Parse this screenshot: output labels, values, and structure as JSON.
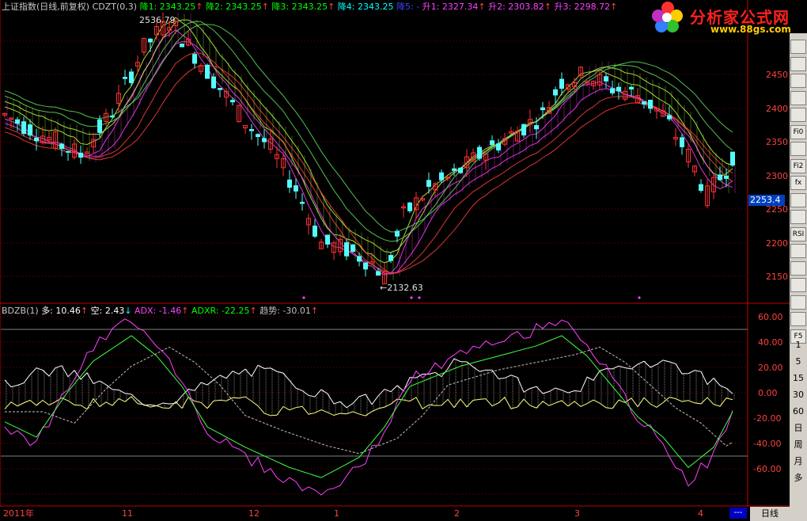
{
  "header": {
    "title": "上证指数(日线,前复权)",
    "indicator": "CDZT(0,3)",
    "items": [
      {
        "label": "降1:",
        "value": "2343.25",
        "color": "#00ff00",
        "arrow": "↑",
        "arrow_color": "#ff4040"
      },
      {
        "label": "降2:",
        "value": "2343.25",
        "color": "#00ff00",
        "arrow": "↑",
        "arrow_color": "#ff4040"
      },
      {
        "label": "降3:",
        "value": "2343.25",
        "color": "#00ff00",
        "arrow": "↑",
        "arrow_color": "#ff4040"
      },
      {
        "label": "降4:",
        "value": "2343.25",
        "color": "#00ffff",
        "arrow": "",
        "arrow_color": "#ff4040"
      },
      {
        "label": "降5:",
        "value": "-",
        "color": "#4040ff",
        "arrow": "",
        "arrow_color": "#ff4040"
      },
      {
        "label": "升1:",
        "value": "2327.34",
        "color": "#ff40ff",
        "arrow": "↑",
        "arrow_color": "#ff4040"
      },
      {
        "label": "升2:",
        "value": "2303.82",
        "color": "#ff40ff",
        "arrow": "↑",
        "arrow_color": "#ff4040"
      },
      {
        "label": "升3:",
        "value": "2298.72",
        "color": "#ff40ff",
        "arrow": "↑",
        "arrow_color": "#ff4040"
      }
    ]
  },
  "logo": {
    "title": "分析家公式网",
    "url": "www.88gs.com"
  },
  "main_panel": {
    "high_marker": "2536.79",
    "low_marker": "←2132.63",
    "current_price": "2253.4",
    "y_ticks": [
      "2450",
      "2400",
      "2350",
      "2300",
      "2250",
      "2200",
      "2150"
    ]
  },
  "sub_panel": {
    "title": "BDZB(1)",
    "items": [
      {
        "label": "多:",
        "value": "10.46",
        "arrow": "↑",
        "color": "#ffffff",
        "arrow_color": "#ff4040"
      },
      {
        "label": "空:",
        "value": "2.43",
        "arrow": "↓",
        "color": "#ffffff",
        "arrow_color": "#00ffff"
      },
      {
        "label": "ADX:",
        "value": "-1.46",
        "arrow": "↑",
        "color": "#ff40ff",
        "arrow_color": "#ff4040"
      },
      {
        "label": "ADXR:",
        "value": "-22.25",
        "arrow": "↑",
        "color": "#00ff00",
        "arrow_color": "#ff4040"
      },
      {
        "label": "趋势:",
        "value": "-30.01",
        "arrow": "↑",
        "color": "#c0c0c0",
        "arrow_color": "#ff4040"
      }
    ],
    "y_ticks": [
      "60.00",
      "40.00",
      "20.00",
      "0.00",
      "-20.00",
      "-40.00",
      "-60.00"
    ]
  },
  "x_axis": {
    "labels": [
      "2011年",
      "11",
      "12",
      "1",
      "2",
      "3",
      "4"
    ]
  },
  "bottom": {
    "period": "日线",
    "nav": "---"
  },
  "toolbar": {
    "buttons": [
      "",
      "",
      "",
      "",
      "",
      "Fi0",
      "",
      "Fi2",
      "fx",
      "",
      "",
      "RSI",
      "",
      "",
      "",
      "",
      "",
      "F5"
    ],
    "numbers": [
      "1",
      "5",
      "15",
      "30",
      "60",
      "日",
      "周",
      "月",
      "多"
    ]
  },
  "colors": {
    "up": "#ff3232",
    "down": "#54fcfc",
    "grid": "#800000",
    "band_green": "#c0ff40",
    "band_magenta": "#ff40ff"
  }
}
